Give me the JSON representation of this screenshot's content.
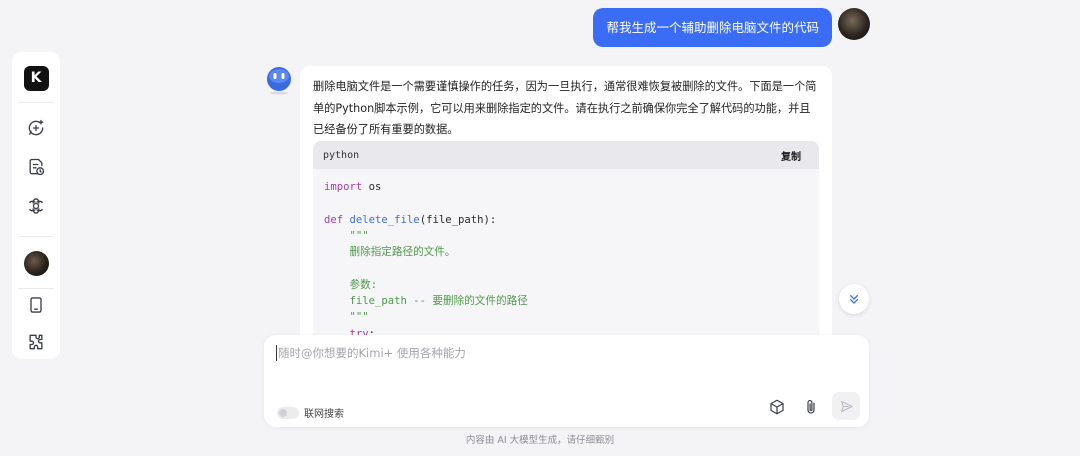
{
  "sidebar": {
    "logo_letter": "K",
    "items": [
      {
        "icon": "new-chat-icon"
      },
      {
        "icon": "history-icon"
      },
      {
        "icon": "explore-icon"
      },
      {
        "icon": "avatar"
      },
      {
        "icon": "tablet-icon"
      },
      {
        "icon": "plugin-icon"
      }
    ]
  },
  "conversation": {
    "user_message": "帮我生成一个辅助删除电脑文件的代码",
    "bot_text": "删除电脑文件是一个需要谨慎操作的任务，因为一旦执行，通常很难恢复被删除的文件。下面是一个简单的Python脚本示例，它可以用来删除指定的文件。请在执行之前确保你完全了解代码的功能，并且已经备份了所有重要的数据。",
    "code": {
      "language": "python",
      "copy_label": "复制",
      "lines": [
        "import os",
        "",
        "def delete_file(file_path):",
        "    \"\"\"",
        "    删除指定路径的文件。",
        "",
        "    参数:",
        "    file_path -- 要删除的文件的路径",
        "    \"\"\"",
        "    try:"
      ]
    }
  },
  "input": {
    "placeholder": "随时@你想要的Kimi+ 使用各种能力",
    "web_search_label": "联网搜索",
    "web_search_enabled": false
  },
  "footer_note": "内容由 AI 大模型生成，请仔细甄别",
  "colors": {
    "accent": "#3b6cf5",
    "background": "#f4f4f7"
  }
}
